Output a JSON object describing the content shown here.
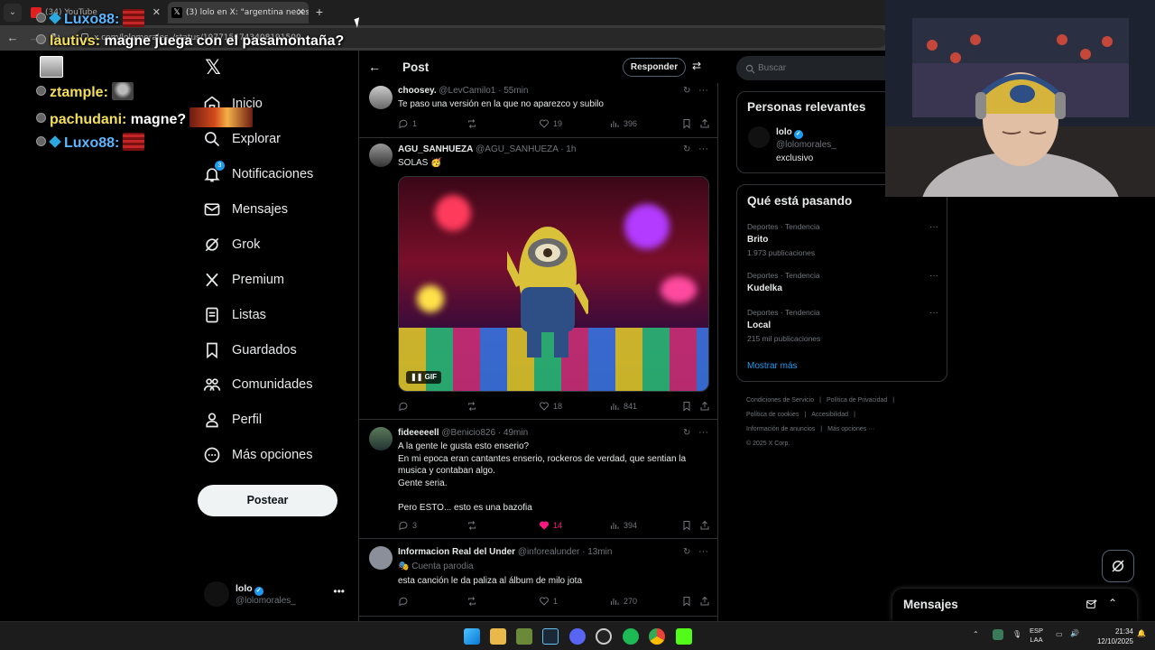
{
  "browser": {
    "tabs": [
      {
        "label": "(34) YouTube",
        "active": false
      },
      {
        "label": "(3) lolo en X: \"argentina necesit...",
        "active": true
      }
    ],
    "url": "x.com/lolomorales_/status/1977156743408191500"
  },
  "chat": [
    {
      "user": "Luxo88:",
      "user_color": "#5bb6ff",
      "message": "",
      "emotes": [
        "red-flag-emote"
      ]
    },
    {
      "user": "lautivs:",
      "user_color": "#f4df5a",
      "message": "magne juega con el pasamontaña?",
      "emotes": []
    },
    {
      "user": "",
      "user_color": "#f4df5a",
      "message": "",
      "emotes": [
        "cat-emote"
      ]
    },
    {
      "user": "ztample:",
      "user_color": "#f4df5a",
      "message": "",
      "emotes": [
        "face-emote"
      ]
    },
    {
      "user": "pachudani:",
      "user_color": "#f4df5a",
      "message": "magne?",
      "emotes": [
        "fire-emote"
      ]
    },
    {
      "user": "Luxo88:",
      "user_color": "#5bb6ff",
      "message": "",
      "emotes": [
        "red-flag-emote"
      ]
    }
  ],
  "nav": {
    "items": [
      {
        "label": "Inicio",
        "icon": "home-icon"
      },
      {
        "label": "Explorar",
        "icon": "search-icon"
      },
      {
        "label": "Notificaciones",
        "icon": "bell-icon",
        "badge": "3"
      },
      {
        "label": "Mensajes",
        "icon": "mail-icon"
      },
      {
        "label": "Grok",
        "icon": "grok-icon"
      },
      {
        "label": "Premium",
        "icon": "x-icon"
      },
      {
        "label": "Listas",
        "icon": "list-icon"
      },
      {
        "label": "Guardados",
        "icon": "bookmark-icon"
      },
      {
        "label": "Comunidades",
        "icon": "people-icon"
      },
      {
        "label": "Perfil",
        "icon": "person-icon"
      },
      {
        "label": "Más opciones",
        "icon": "more-circle-icon"
      }
    ],
    "post_button": "Postear",
    "account": {
      "name": "lolo",
      "handle": "@lolomorales_"
    }
  },
  "main": {
    "title": "Post",
    "reply_button": "Responder",
    "tweets": [
      {
        "name": "choosey.",
        "handle": "@LevCamilo1 · 55min",
        "text": "Te paso una versión en la que no aparezco y subilo",
        "replies": "1",
        "reposts": "",
        "likes": "19",
        "views": "396",
        "liked": false
      },
      {
        "name": "AGU_SANHUEZA",
        "handle": "@AGU_SANHUEZA · 1h",
        "text": "SOLAS 🥳",
        "gif_label": "GIF",
        "replies": "",
        "reposts": "",
        "likes": "18",
        "views": "841",
        "liked": false
      },
      {
        "name": "fideeeeell",
        "handle": "@Benicio826 · 49min",
        "text": "A la gente le gusta esto enserio?\nEn mi epoca eran cantantes enserio, rockeros de verdad, que sentian la musica y contaban algo.\nGente seria.\n\nPero ESTO... esto es una bazofia",
        "replies": "3",
        "reposts": "",
        "likes": "14",
        "views": "394",
        "liked": true
      },
      {
        "name": "Informacion Real del Under",
        "handle": "@inforealunder · 13min",
        "subtitle": "Cuenta parodia",
        "text": "esta canción le da paliza al álbum de milo jota",
        "replies": "",
        "reposts": "",
        "likes": "1",
        "views": "270",
        "liked": false
      }
    ]
  },
  "right": {
    "search_placeholder": "Buscar",
    "relevant": {
      "title": "Personas relevantes",
      "name": "lolo",
      "handle": "@lolomorales_",
      "bio": "exclusivo"
    },
    "trending": {
      "title": "Qué está pasando",
      "items": [
        {
          "category": "Deportes · Tendencia",
          "topic": "Brito",
          "count": "1.973 publicaciones"
        },
        {
          "category": "Deportes · Tendencia",
          "topic": "Kudelka",
          "count": ""
        },
        {
          "category": "Deportes · Tendencia",
          "topic": "Local",
          "count": "215 mil publicaciones"
        }
      ],
      "show_more": "Mostrar más"
    },
    "footer": [
      "Condiciones de Servicio",
      "|",
      "Política de Privacidad",
      "|",
      "Política de cookies",
      "|",
      "Accesibilidad",
      "|",
      "Información de anuncios",
      "|",
      "Más opciones ···",
      "© 2025 X Corp."
    ]
  },
  "messages_drawer": {
    "title": "Mensajes"
  },
  "taskbar": {
    "lang_top": "ESP",
    "lang_bottom": "LAA",
    "time": "21:34",
    "date": "12/10/2025"
  },
  "colors": {
    "accent": "#1d9bf0",
    "like": "#f91880",
    "background": "#000000"
  }
}
